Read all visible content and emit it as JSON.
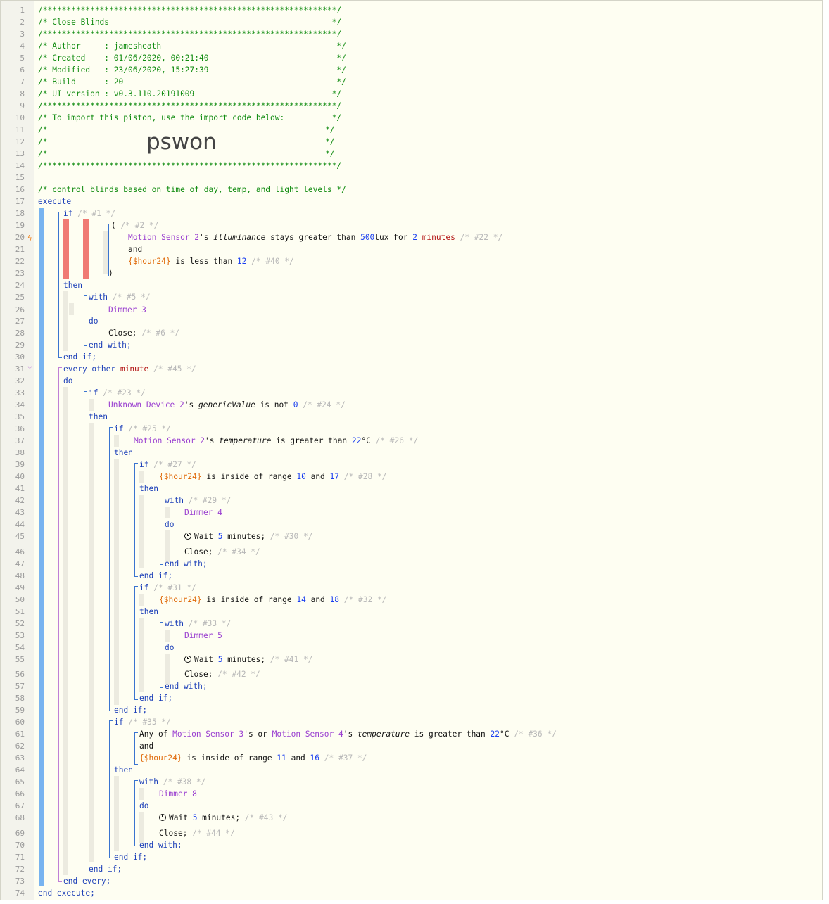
{
  "header": {
    "stars": "/**************************************************************/",
    "title_line": "/* Close Blinds                                               */",
    "author_line": "/* Author     : jamesheath                                     */",
    "created_line": "/* Created    : 01/06/2020, 00:21:40                           */",
    "modified_line": "/* Modified   : 23/06/2020, 15:27:39                           */",
    "build_line": "/* Build      : 20                                             */",
    "ui_line": "/* UI version : v0.3.110.20191009                             */",
    "import_line": "/* To import this piston, use the import code below:          */",
    "blank_left": "/*",
    "blank_right": "*/",
    "import_code": "pswon"
  },
  "comment_line": "/* control blinds based on time of day, temp, and light levels */",
  "kw": {
    "execute": "execute",
    "end_execute": "end execute;",
    "if": "if",
    "then": "then",
    "end_if": "end if;",
    "with": "with",
    "do": "do",
    "end_with": "end with;",
    "every": "every other",
    "minute": "minute",
    "end_every": "end every;",
    "and": "and",
    "or": "or",
    "paren_open": "(",
    "paren_close": ")"
  },
  "text": {
    "stays_gt": " stays greater than ",
    "lux": "lux for ",
    "less_than": " is less than ",
    "is_not": " is not ",
    "greater_than": " is greater than ",
    "celsius": "°C ",
    "inside_range": " is inside of range ",
    "wait": "Wait ",
    "minutes_sc": " minutes; ",
    "close": "Close; ",
    "any_of": "Any of ",
    "s": "'s ",
    "space": " "
  },
  "devices": {
    "motion2": "Motion Sensor 2",
    "motion3": "Motion Sensor 3",
    "motion4": "Motion Sensor 4",
    "unknown2": "Unknown Device 2",
    "dimmer3": "Dimmer 3",
    "dimmer4": "Dimmer 4",
    "dimmer5": "Dimmer 5",
    "dimmer8": "Dimmer 8"
  },
  "attrs": {
    "illuminance": "illuminance",
    "genericValue": "genericValue",
    "temperature": "temperature"
  },
  "values": {
    "hour24": "{$hour24}",
    "v500": "500",
    "v2": "2",
    "v12": "12",
    "v0": "0",
    "v22": "22",
    "v10": "10",
    "v17": "17",
    "v5": "5",
    "v14": "14",
    "v18": "18",
    "v11": "11",
    "v16": "16",
    "minutes": "minutes"
  },
  "ids": {
    "i1": "/* #1 */",
    "i2": "/* #2 */",
    "i22": "/* #22 */",
    "i40": "/* #40 */",
    "i5": "/* #5 */",
    "i6": "/* #6 */",
    "i45": "/* #45 */",
    "i23": "/* #23 */",
    "i24": "/* #24 */",
    "i25": "/* #25 */",
    "i26": "/* #26 */",
    "i27": "/* #27 */",
    "i28": "/* #28 */",
    "i29": "/* #29 */",
    "i30": "/* #30 */",
    "i34": "/* #34 */",
    "i31": "/* #31 */",
    "i32": "/* #32 */",
    "i33": "/* #33 */",
    "i41": "/* #41 */",
    "i42": "/* #42 */",
    "i35": "/* #35 */",
    "i36": "/* #36 */",
    "i37": "/* #37 */",
    "i38": "/* #38 */",
    "i43": "/* #43 */",
    "i44": "/* #44 */"
  },
  "line_numbers": [
    "1",
    "2",
    "3",
    "4",
    "5",
    "6",
    "7",
    "8",
    "9",
    "10",
    "11",
    "12",
    "13",
    "14",
    "15",
    "16",
    "17",
    "18",
    "19",
    "20",
    "21",
    "22",
    "23",
    "24",
    "25",
    "26",
    "27",
    "28",
    "29",
    "30",
    "31",
    "32",
    "33",
    "34",
    "35",
    "36",
    "37",
    "38",
    "39",
    "40",
    "41",
    "42",
    "43",
    "44",
    "45",
    "46",
    "47",
    "48",
    "49",
    "50",
    "51",
    "52",
    "53",
    "54",
    "55",
    "56",
    "57",
    "58",
    "59",
    "60",
    "61",
    "62",
    "63",
    "64",
    "65",
    "66",
    "67",
    "68",
    "69",
    "70",
    "71",
    "72",
    "73",
    "74"
  ],
  "colors": {
    "keyword": "#1c3fb8",
    "device": "#9a3fd0",
    "number": "#1a3ff0",
    "variable": "#e06a0a",
    "comment_green": "#0f8b0f",
    "id_comment": "#b8b8b8",
    "condition_bar": "#f07a74",
    "execute_bar": "#78b4f0"
  }
}
